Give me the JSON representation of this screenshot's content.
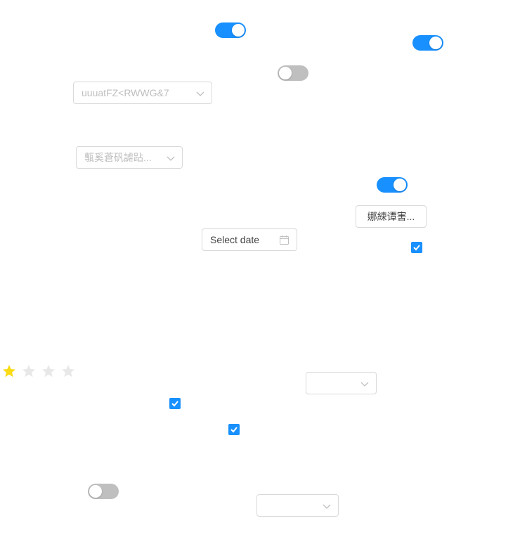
{
  "switches": [
    {
      "state": "on"
    },
    {
      "state": "on"
    },
    {
      "state": "off"
    },
    {
      "state": "on"
    },
    {
      "state": "off"
    }
  ],
  "selects": [
    {
      "value": "uuuatFZ<RWWG&7"
    },
    {
      "value": "甎奚蒼矾謔跕..."
    },
    {
      "value": ""
    },
    {
      "value": ""
    }
  ],
  "button": {
    "label": "娜綀谭害..."
  },
  "datepicker": {
    "placeholder": "Select date",
    "icon": "calendar-icon"
  },
  "checkboxes": [
    {
      "checked": true
    },
    {
      "checked": true
    },
    {
      "checked": true
    }
  ],
  "rating": {
    "value": 1,
    "max": 4,
    "active_color": "#fadb14",
    "inactive_color": "#e8e8e8"
  },
  "colors": {
    "primary": "#1890ff",
    "switch_off": "#bfbfbf",
    "border": "#d9d9d9"
  }
}
